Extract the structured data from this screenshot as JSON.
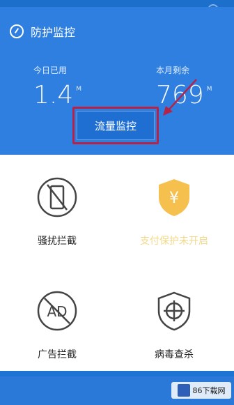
{
  "header": {
    "title": "防护监控",
    "stats": [
      {
        "caption": "今日已用",
        "value": "1.4",
        "unit": "M"
      },
      {
        "caption": "本月剩余",
        "value": "769",
        "unit": "M"
      }
    ],
    "button_label": "流量监控"
  },
  "features": [
    {
      "label": "骚扰拦截",
      "icon": "phone-block-icon"
    },
    {
      "label": "支付保护未开启",
      "icon": "yen-shield-icon"
    },
    {
      "label": "广告拦截",
      "icon": "ad-block-icon"
    },
    {
      "label": "病毒查杀",
      "icon": "crosshair-shield-icon"
    }
  ],
  "watermark": {
    "text": "86下载网"
  },
  "colors": {
    "header_bg": "#2f7fe0",
    "highlight": "#b3234a",
    "warning": "#f5c04d"
  }
}
